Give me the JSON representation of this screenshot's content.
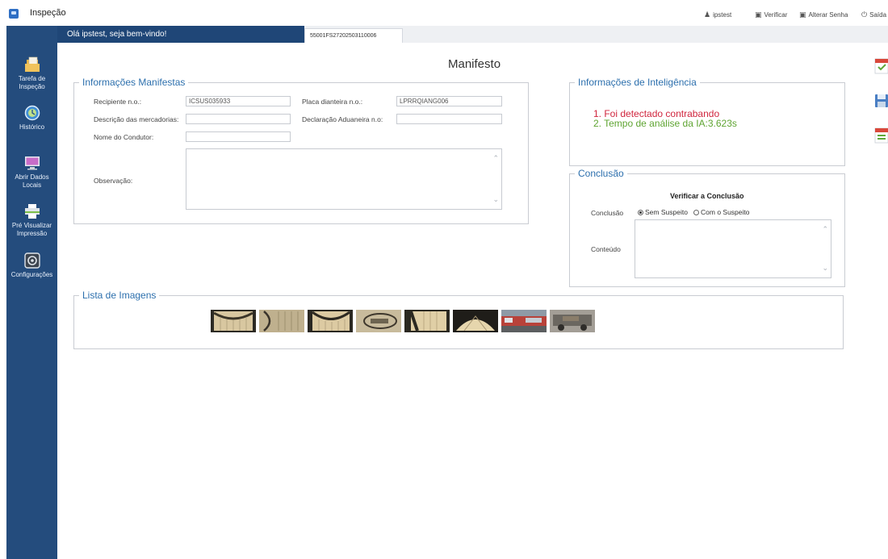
{
  "app": {
    "title": "Inspeção"
  },
  "topbar": {
    "user": "ipstest",
    "verify": "Verificar",
    "change_password": "Alterar Senha",
    "exit": "Saída"
  },
  "sidebar": {
    "items": [
      {
        "label": "Tarefa de Inspeção",
        "icon": "folder-task-icon"
      },
      {
        "label": "Histórico",
        "icon": "clock-history-icon"
      },
      {
        "label": "Abrir Dados Locais",
        "icon": "monitor-icon"
      },
      {
        "label": "Pré Visualizar Impressão",
        "icon": "printer-icon"
      },
      {
        "label": "Configurações",
        "icon": "gear-icon"
      }
    ]
  },
  "tabs": {
    "welcome": "Olá ipstest, seja bem-vindo!",
    "document": "55001FS27202503110006"
  },
  "page": {
    "title": "Manifesto"
  },
  "manifest": {
    "legend": "Informações Manifestas",
    "recipient_label": "Recipiente n.o.:",
    "recipient_value": "ICSUS035933",
    "front_plate_label": "Placa dianteira n.o.:",
    "front_plate_value": "LPRRQIANG006",
    "goods_label": "Descrição das mercadorias:",
    "goods_value": "",
    "customs_label": "Declaração Aduaneira n.o:",
    "customs_value": "",
    "driver_label": "Nome do Condutor:",
    "driver_value": "",
    "notes_label": "Observação:"
  },
  "intelligence": {
    "legend": "Informações de Inteligência",
    "line1": "1. Foi detectado contrabando",
    "line2": "2. Tempo de análise da IA:3.623s",
    "line1_color": "#d0263e",
    "line2_color": "#5ea431"
  },
  "conclusion": {
    "legend": "Conclusão",
    "heading": "Verificar a Conclusão",
    "conclusion_label": "Conclusão",
    "option_no_suspect": "Sem Suspeito",
    "option_suspect": "Com o Suspeito",
    "selected": "Sem Suspeito",
    "content_label": "Conteúdo"
  },
  "images": {
    "legend": "Lista de Imagens",
    "count": 8
  },
  "colors": {
    "sidebar": "#244c7d",
    "tab_active": "#1f4677",
    "legend_text": "#2c6fad"
  }
}
